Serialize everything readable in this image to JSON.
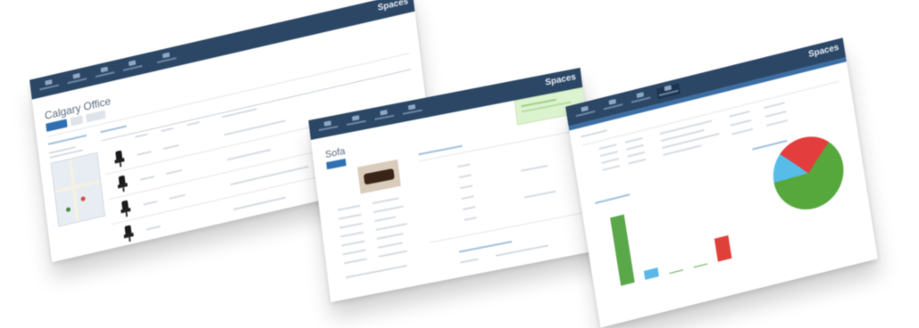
{
  "screens": [
    {
      "id": "office-detail",
      "title": "Calgary Office",
      "brand": "Spaces"
    },
    {
      "id": "asset-detail",
      "title": "Sofa",
      "brand": "Spaces"
    },
    {
      "id": "dashboard",
      "brand": "Spaces"
    }
  ],
  "chart_data": [
    {
      "type": "bar",
      "categories": [
        "",
        "",
        "",
        "",
        ""
      ],
      "values": [
        60,
        8,
        0,
        0,
        20
      ],
      "colors": [
        "#5aa84a",
        "#5ab8e6",
        "#5aa84a",
        "#5aa84a",
        "#e0403a"
      ]
    },
    {
      "type": "pie",
      "values": [
        62,
        13,
        25
      ],
      "colors": [
        "#56a83c",
        "#57bde8",
        "#e33d3d"
      ]
    }
  ]
}
